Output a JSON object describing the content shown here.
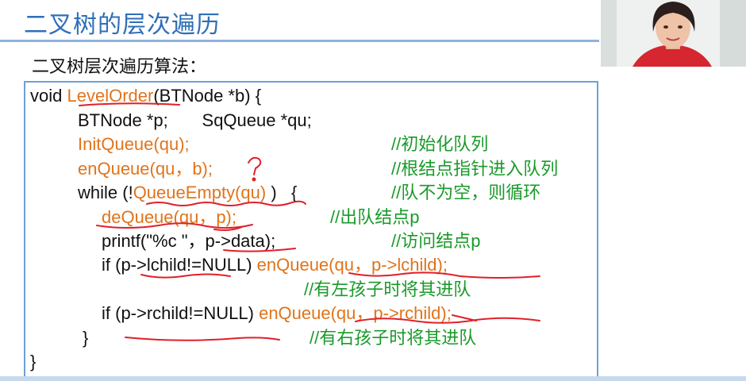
{
  "slide": {
    "title": "二叉树的层次遍历",
    "subtitle": "二叉树层次遍历算法："
  },
  "code": {
    "l1_a": "void ",
    "l1_fn": "LevelOrder",
    "l1_b": "(BTNode *b) {",
    "l2": "BTNode *p;       SqQueue *qu;",
    "l3": "InitQueue(qu);",
    "l3_c": "//初始化队列",
    "l4": "enQueue(qu，b);",
    "l4_c": "//根结点指针进入队列",
    "l5_a": "while (!",
    "l5_fn": "QueueEmpty(qu)",
    "l5_b": " )   {",
    "l5_c": "//队不为空，则循环",
    "l6": "deQueue(qu，p);",
    "l6_c": "//出队结点p",
    "l7": "printf(\"%c \"，p->data);",
    "l7_c": "//访问结点p",
    "l8_a": "if (p->lchild!=NULL) ",
    "l8_b": "enQueue(qu，p->lchild);",
    "l9_c": "//有左孩子时将其进队",
    "l10_a": "if (p->rchild!=NULL) ",
    "l10_b": "enQueue(qu，p->rchild);",
    "l11": "}",
    "l11_c": "//有右孩子时将其进队",
    "l12": "}"
  },
  "colors": {
    "title": "#2f6fb8",
    "keyword_orange": "#e0741c",
    "comment_green": "#1a9a2a",
    "annotation_red": "#e0202a",
    "box_border": "#6fa0d8"
  },
  "webcam": {
    "icon": "presenter-video-feed"
  }
}
